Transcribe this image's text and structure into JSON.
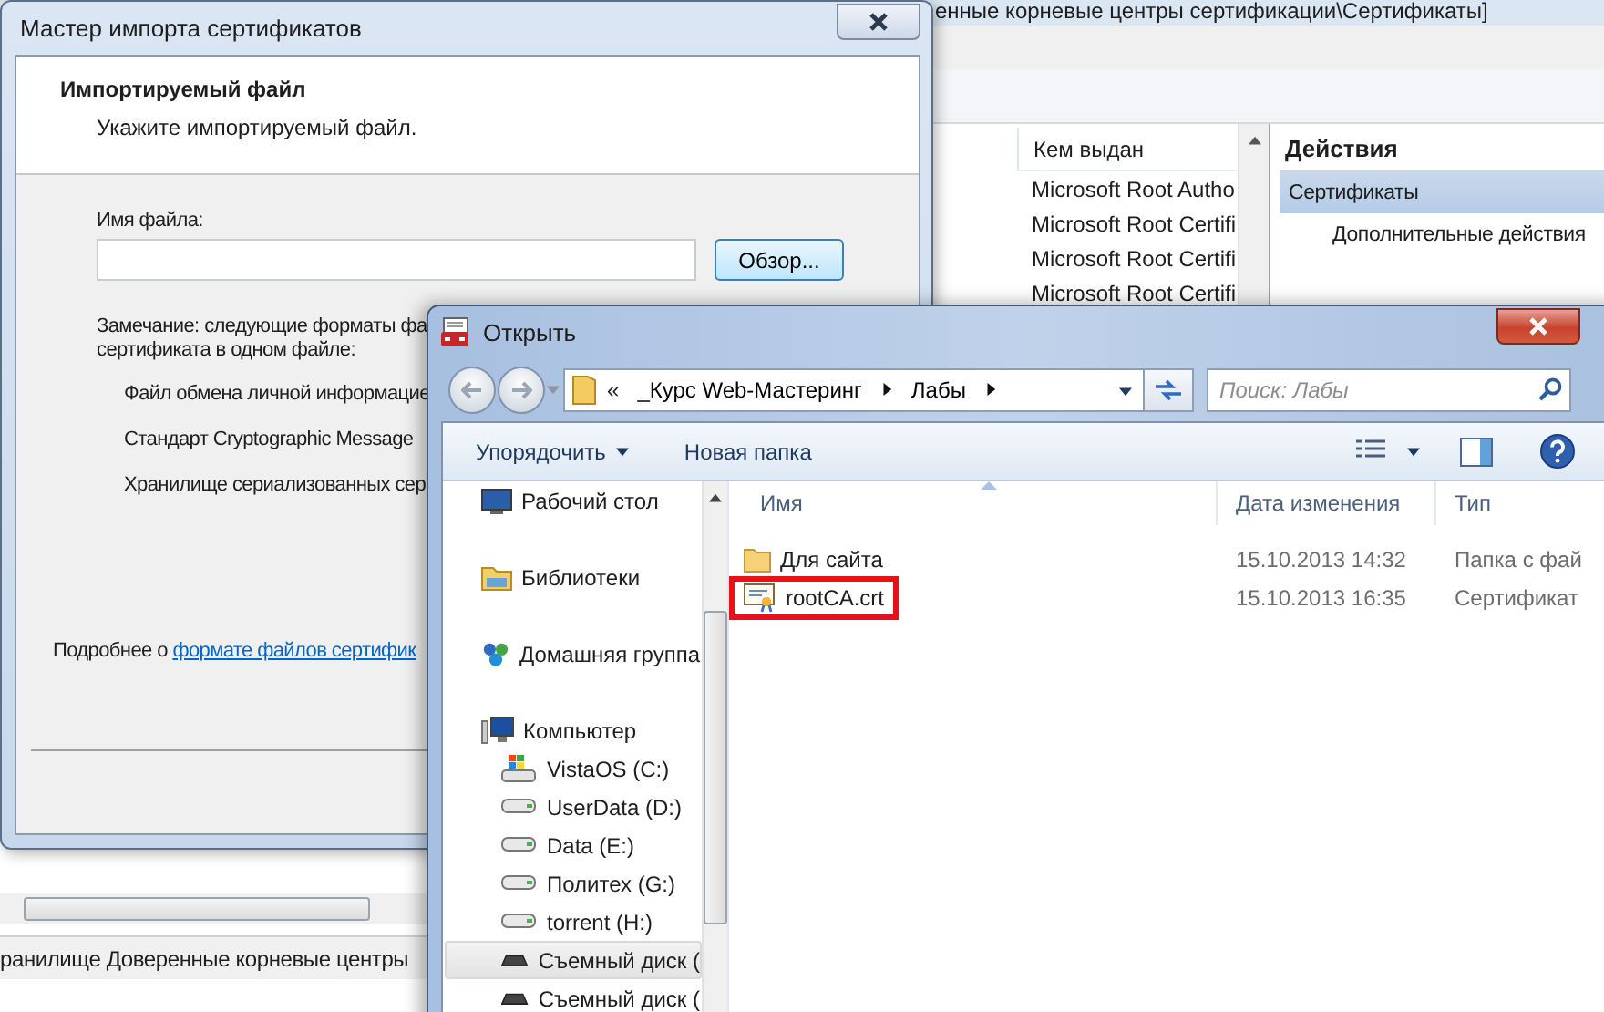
{
  "background_window": {
    "title": "енные корневые центры сертификации\\Сертификаты]",
    "list": {
      "column": "Кем выдан",
      "rows": [
        "Microsoft Root Autho",
        "Microsoft Root Certifi",
        "Microsoft Root Certifi",
        "Microsoft Root Certifi"
      ]
    },
    "actions": {
      "title": "Действия",
      "items": [
        {
          "label": "Сертификаты",
          "selected": true
        },
        {
          "label": "Дополнительные действия",
          "selected": false
        }
      ]
    },
    "status_bar": "ранилище Доверенные корневые центры"
  },
  "wizard": {
    "title": "Мастер импорта сертификатов",
    "heading": "Импортируемый файл",
    "subheading": "Укажите импортируемый файл.",
    "file_name": {
      "label": "Имя файла:"
    },
    "browse_button": "Обзор...",
    "note": [
      "Замечание: следующие форматы фа",
      "сертификата в одном файле:"
    ],
    "formats": [
      "Файл обмена личной информацие",
      "Стандарт Cryptographic Message",
      "Хранилище сериализованных сер"
    ],
    "more_info": {
      "text": "Подробнее о",
      "link": "формате файлов сертифик"
    }
  },
  "open_dialog": {
    "title": "Открыть",
    "path": {
      "prefix": "«",
      "segments": [
        "_Курс Web-Мастеринг",
        "Лабы"
      ]
    },
    "search": {
      "placeholder": "Поиск: Лабы"
    },
    "toolbar": {
      "organize": "Упорядочить",
      "new_folder": "Новая папка"
    },
    "nav": [
      {
        "label": "Рабочий стол",
        "kind": "desktop",
        "selected": false
      },
      {
        "label": "Библиотеки",
        "kind": "libraries",
        "selected": false
      },
      {
        "label": "Домашняя группа",
        "kind": "homegroup",
        "selected": false
      },
      {
        "label": "Компьютер",
        "kind": "computer",
        "selected": false,
        "children": [
          {
            "label": "VistaOS (C:)",
            "kind": "system-drive",
            "selected": false
          },
          {
            "label": "UserData (D:)",
            "kind": "drive",
            "selected": false
          },
          {
            "label": "Data (E:)",
            "kind": "drive",
            "selected": false
          },
          {
            "label": "Политех (G:)",
            "kind": "drive",
            "selected": false
          },
          {
            "label": "torrent (H:)",
            "kind": "drive",
            "selected": false
          },
          {
            "label": "Съемный диск (",
            "kind": "removable",
            "selected": true
          },
          {
            "label": "Съемный диск (",
            "kind": "removable",
            "selected": false
          }
        ]
      }
    ],
    "columns": [
      "Имя",
      "Дата изменения",
      "Тип"
    ],
    "files": [
      {
        "name": "Для сайта",
        "kind": "folder",
        "modified": "15.10.2013 14:32",
        "type": "Папка с фай",
        "highlighted": false
      },
      {
        "name": "rootCA.crt",
        "kind": "certificate",
        "modified": "15.10.2013 16:35",
        "type": "Сертификат",
        "highlighted": true
      }
    ]
  }
}
